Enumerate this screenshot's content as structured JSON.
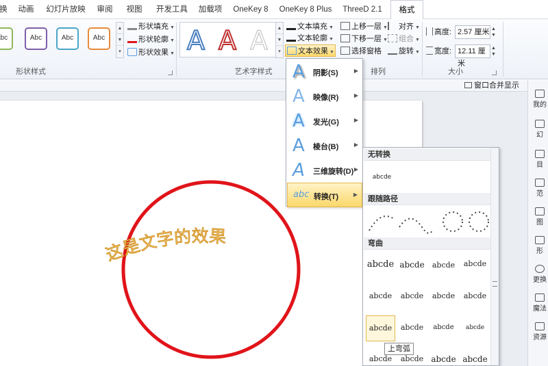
{
  "tabs": [
    "换",
    "动画",
    "幻灯片放映",
    "审阅",
    "视图",
    "开发工具",
    "加载项",
    "OneKey 8",
    "OneKey 8 Plus",
    "ThreeD 2.1",
    "格式"
  ],
  "ribbon": {
    "shape_styles": {
      "gallery": [
        "Abc",
        "Abc",
        "Abc",
        "Abc"
      ],
      "fill": "形状填充",
      "outline": "形状轮廓",
      "effects": "形状效果",
      "label": "形状样式"
    },
    "wordart": {
      "gallery": [
        "A",
        "A",
        "A"
      ],
      "text_fill": "文本填充",
      "text_outline": "文本轮廓",
      "text_effects": "文本效果",
      "label": "艺术字样式"
    },
    "arrange": {
      "bring_forward": "上移一层",
      "send_backward": "下移一层",
      "selection_pane": "选择窗格",
      "align": "对齐",
      "group": "组合",
      "rotate": "旋转",
      "label": "排列"
    },
    "size": {
      "height_label": "高度:",
      "height_value": "2.57 厘米",
      "width_label": "宽度:",
      "width_value": "12.11 厘米",
      "label": "大小"
    }
  },
  "workspace": {
    "window_merge": "窗口合并显示",
    "wordart_text": "这是文字的效果"
  },
  "right_pane": [
    "我的",
    "幻",
    "目",
    "范",
    "图",
    "形",
    "更换",
    "魔法",
    "资源"
  ],
  "text_effects_menu": [
    {
      "label": "阴影(S)"
    },
    {
      "label": "映像(R)"
    },
    {
      "label": "发光(G)"
    },
    {
      "label": "棱台(B)"
    },
    {
      "label": "三维旋转(D)"
    },
    {
      "label": "转换(T)"
    }
  ],
  "transform_submenu": {
    "no_transform": "无转换",
    "no_transform_sample": "abcde",
    "follow_path": "跟随路径",
    "warp": "弯曲",
    "warp_samples": [
      "abcde",
      "abcde",
      "abcde",
      "abcde",
      "abcde",
      "abcde",
      "abcde",
      "abcde",
      "abcde",
      "abcde",
      "abcde",
      "abcde",
      "abcde",
      "abcde",
      "abcde",
      "abcde"
    ],
    "tooltip": "上弯弧"
  },
  "colors": {
    "accent_gold": "#e0a72c",
    "circle_red": "#e0141a"
  }
}
